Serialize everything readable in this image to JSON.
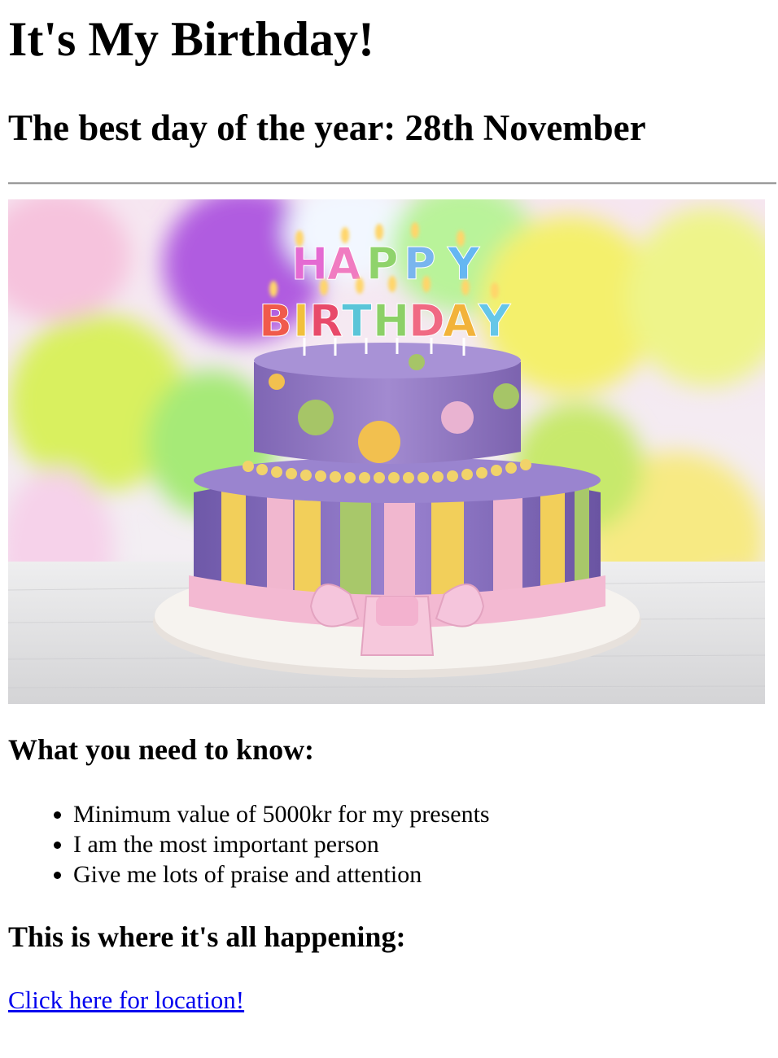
{
  "header": {
    "title": "It's My Birthday!",
    "subtitle": "The best day of the year: 28th November"
  },
  "image": {
    "candle_letters_top": "HAPPY",
    "candle_letters_bottom": "BIRTHDAY",
    "colors": {
      "cake_top": "#9b7fc4",
      "cake_bottom": "#8a70c6",
      "stripe_yellow": "#f2cf5a",
      "stripe_green": "#a8c86a",
      "stripe_pink": "#f1b7cf",
      "plate": "#f4f1ee"
    }
  },
  "info": {
    "heading": "What you need to know:",
    "items": [
      "Minimum value of 5000kr for my presents",
      "I am the most important person",
      "Give me lots of praise and attention"
    ]
  },
  "location": {
    "heading": "This is where it's all happening:",
    "link_text": "Click here for location!"
  }
}
